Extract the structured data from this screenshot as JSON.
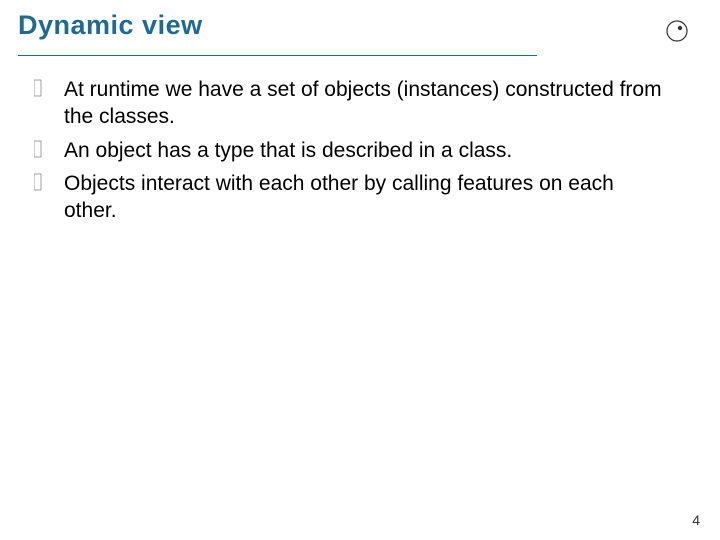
{
  "slide": {
    "title": "Dynamic view",
    "bullets": [
      "At runtime we have a set of objects (instances) constructed from the classes.",
      "An object has a type that is described in a class.",
      "Objects interact with each other by calling features on each other."
    ],
    "page_number": "4"
  }
}
